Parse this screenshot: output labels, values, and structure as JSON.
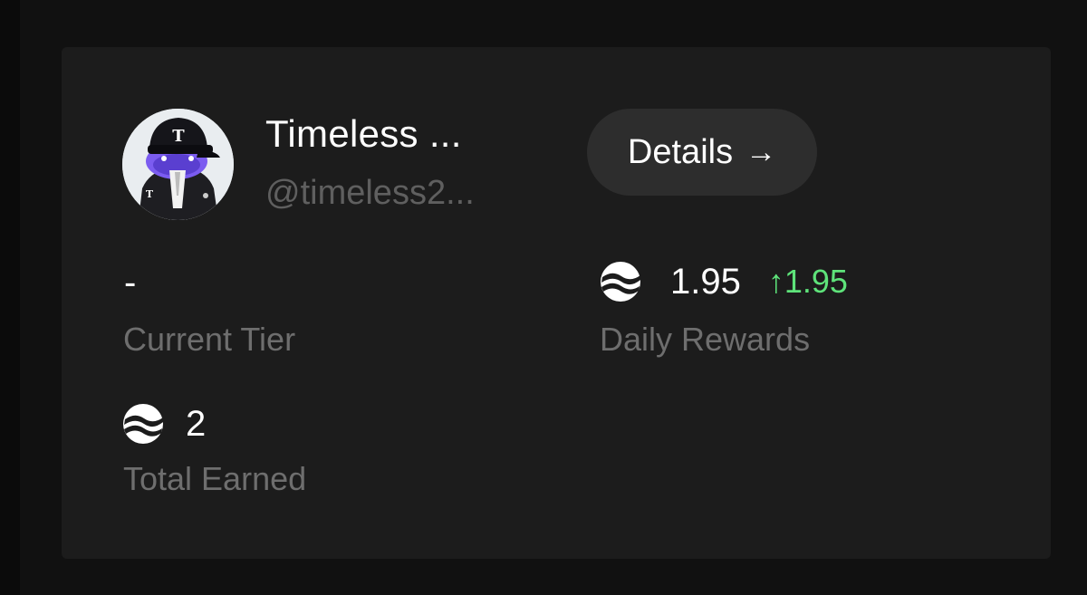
{
  "profile": {
    "name": "Timeless ...",
    "handle": "@timeless2...",
    "avatar_cap_letter": "T",
    "avatar_jacket_letter": "T"
  },
  "details_button": {
    "label": "Details",
    "arrow": "→"
  },
  "stats": {
    "current_tier": {
      "value": "-",
      "label": "Current Tier"
    },
    "daily_rewards": {
      "icon": "token-icon",
      "value": "1.95",
      "delta": "↑1.95",
      "label": "Daily Rewards"
    },
    "total_earned": {
      "icon": "token-icon",
      "value": "2",
      "label": "Total Earned"
    }
  },
  "colors": {
    "background": "#0b0b0b",
    "card": "#1c1c1c",
    "button": "#2d2d2d",
    "positive": "#5ee37a",
    "muted_text": "#6e6e6e"
  }
}
